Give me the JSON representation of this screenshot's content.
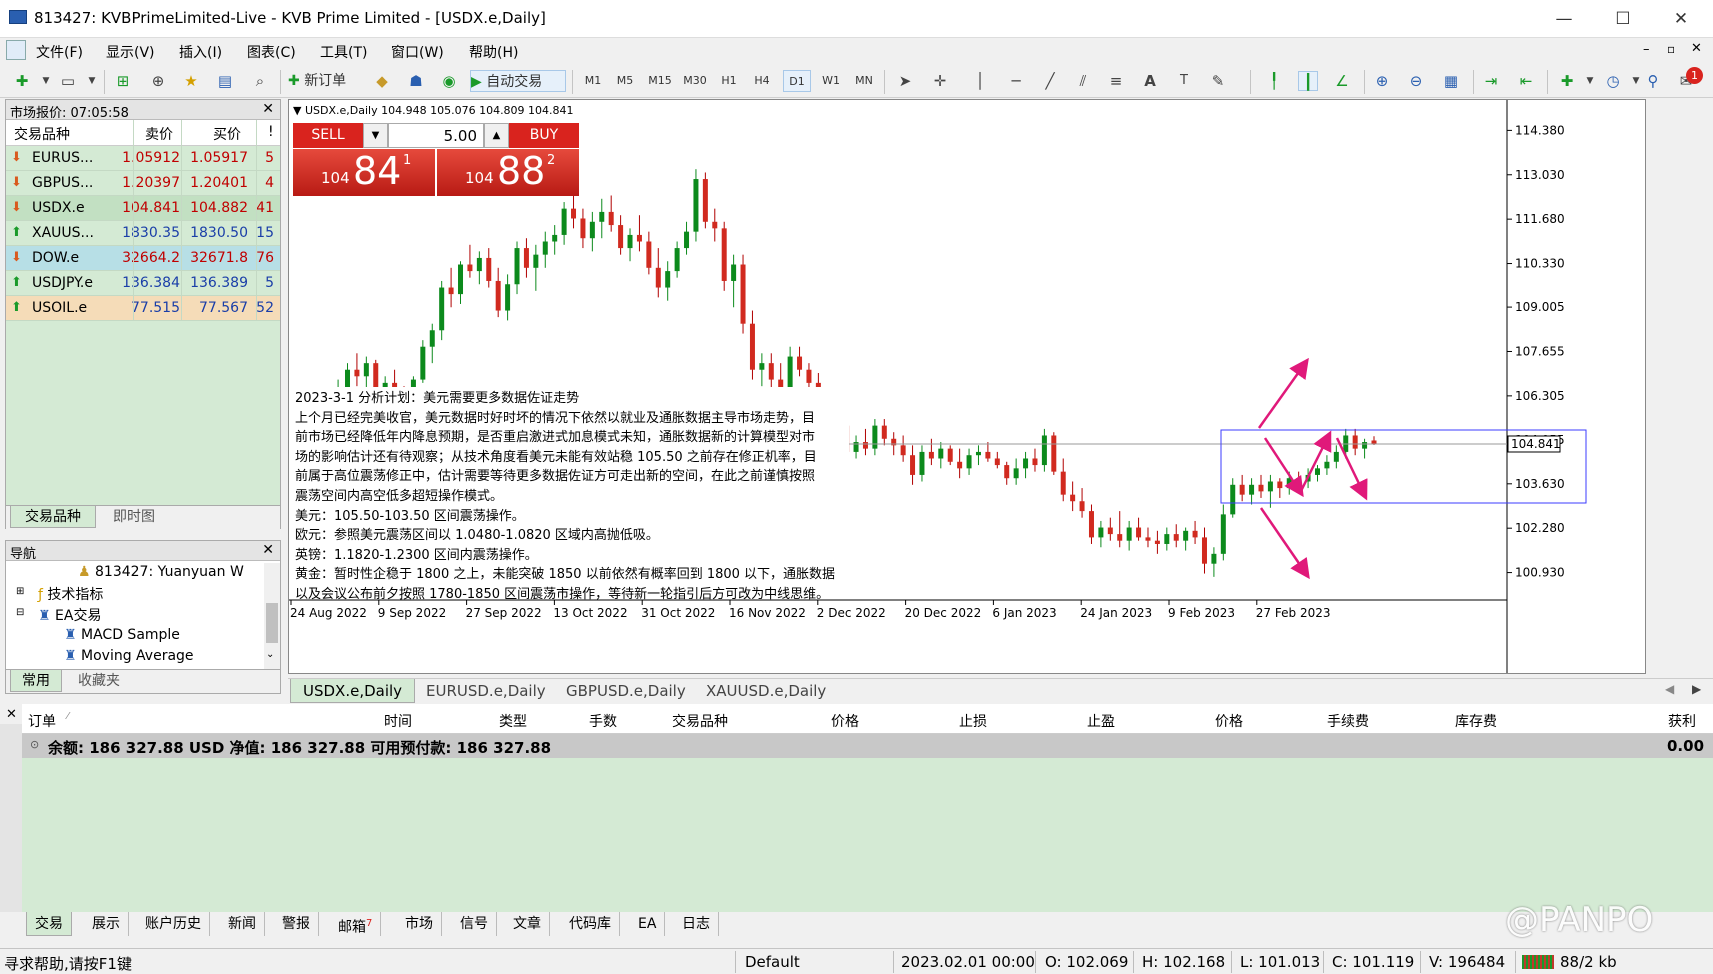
{
  "window": {
    "title": "813427: KVBPrimeLimited-Live - KVB Prime Limited - [USDX.e,Daily]"
  },
  "menu": [
    "文件(F)",
    "显示(V)",
    "插入(I)",
    "图表(C)",
    "工具(T)",
    "窗口(W)",
    "帮助(H)"
  ],
  "toolbar": {
    "new_order": "新订单",
    "auto_trade": "自动交易",
    "timeframes": [
      "M1",
      "M5",
      "M15",
      "M30",
      "H1",
      "H4",
      "D1",
      "W1",
      "MN"
    ],
    "notification_count": "1"
  },
  "market_watch": {
    "title": "市场报价: 07:05:58",
    "col_symbol": "交易品种",
    "col_bid": "卖价",
    "col_ask": "买价",
    "col_spread": "!",
    "rows": [
      {
        "symbol": "EURUS...",
        "bid": "1.05912",
        "ask": "1.05917",
        "spread": "5",
        "dir": "down",
        "bg": "#d4ead4",
        "color": "#c00000"
      },
      {
        "symbol": "GBPUS...",
        "bid": "1.20397",
        "ask": "1.20401",
        "spread": "4",
        "dir": "down",
        "bg": "#d4ead4",
        "color": "#c00000"
      },
      {
        "symbol": "USDX.e",
        "bid": "104.841",
        "ask": "104.882",
        "spread": "41",
        "dir": "down",
        "bg": "#c2e0c2",
        "color": "#c00000"
      },
      {
        "symbol": "XAUUS...",
        "bid": "1830.35",
        "ask": "1830.50",
        "spread": "15",
        "dir": "up",
        "bg": "#d4ead4",
        "color": "#1a3ea8"
      },
      {
        "symbol": "DOW.e",
        "bid": "32664.2",
        "ask": "32671.8",
        "spread": "76",
        "dir": "down",
        "bg": "#b7dfe6",
        "color": "#c00000"
      },
      {
        "symbol": "USDJPY.e",
        "bid": "136.384",
        "ask": "136.389",
        "spread": "5",
        "dir": "up",
        "bg": "#d4ead4",
        "color": "#1a3ea8"
      },
      {
        "symbol": "USOIL.e",
        "bid": "77.515",
        "ask": "77.567",
        "spread": "52",
        "dir": "up",
        "bg": "#f5dcb8",
        "color": "#1a3ea8"
      }
    ],
    "tabs": [
      "交易品种",
      "即时图"
    ]
  },
  "navigator": {
    "title": "导航",
    "account": "813427: Yuanyuan W",
    "indicators": "技术指标",
    "ea": "EA交易",
    "items": [
      "MACD Sample",
      "Moving Average"
    ],
    "tabs": [
      "常用",
      "收藏夹"
    ]
  },
  "chart": {
    "header": "USDX.e,Daily  104.948 105.076 104.809 104.841",
    "sell": "SELL",
    "buy": "BUY",
    "lot": "5.00",
    "sell_price": {
      "small": "104",
      "big": "84",
      "sup": "1"
    },
    "buy_price": {
      "small": "104",
      "big": "88",
      "sup": "2"
    },
    "current_price": "104.841",
    "price_labels": [
      "114.380",
      "113.030",
      "111.680",
      "110.330",
      "109.005",
      "107.655",
      "106.305",
      "104.955",
      "103.630",
      "102.280",
      "100.930"
    ],
    "date_labels": [
      "24 Aug 2022",
      "9 Sep 2022",
      "27 Sep 2022",
      "13 Oct 2022",
      "31 Oct 2022",
      "16 Nov 2022",
      "2 Dec 2022",
      "20 Dec 2022",
      "6 Jan 2023",
      "24 Jan 2023",
      "9 Feb 2023",
      "27 Feb 2023"
    ],
    "note": [
      "2023-3-1 分析计划：美元需要更多数据佐证走势",
      "上个月已经完美收官，美元数据时好时坏的情况下依然以就业及通胀数据主导市场走势，目",
      "前市场已经降低年内降息预期，是否重启激进式加息模式未知，通胀数据新的计算模型对市",
      "场的影响估计还有待观察；从技术角度看美元未能有效站稳 105.50 之前存在修正机率，目",
      "前属于高位震荡修正中，估计需要等待更多数据佐证方可走出新的空间，在此之前谨慎按照",
      "震荡空间内高空低多超短操作模式。",
      "美元：105.50-103.50 区间震荡操作。",
      "欧元：参照美元震荡区间以 1.0480-1.0820 区域内高抛低吸。",
      "英镑：1.1820-1.2300 区间内震荡操作。",
      "黄金：暂时性企稳于 1800 之上，未能突破 1850 以前依然有概率回到 1800 以下，通胀数据",
      "以及会议公布前夕按照 1780-1850 区间震荡市操作，等待新一轮指引后方可改为中线思维。"
    ],
    "tabs": [
      "USDX.e,Daily",
      "EURUSD.e,Daily",
      "GBPUSD.e,Daily",
      "XAUUSD.e,Daily"
    ]
  },
  "chart_data": {
    "type": "candlestick",
    "title": "USDX.e,Daily",
    "ylim": [
      100.4,
      115.0
    ],
    "candles": [
      [
        105.3,
        105.6,
        104.6,
        105.0
      ],
      [
        105.0,
        105.4,
        104.3,
        104.9
      ],
      [
        104.9,
        105.5,
        104.6,
        105.3
      ],
      [
        105.3,
        105.8,
        105.0,
        105.6
      ],
      [
        105.6,
        106.3,
        105.3,
        106.1
      ],
      [
        106.1,
        106.8,
        105.6,
        106.5
      ],
      [
        106.5,
        107.3,
        106.2,
        107.1
      ],
      [
        107.1,
        107.6,
        106.6,
        106.9
      ],
      [
        106.9,
        107.5,
        106.5,
        107.3
      ],
      [
        107.3,
        107.4,
        105.8,
        106.0
      ],
      [
        106.0,
        106.9,
        105.7,
        106.7
      ],
      [
        106.7,
        107.1,
        106.0,
        106.3
      ],
      [
        106.3,
        106.6,
        105.9,
        106.1
      ],
      [
        106.1,
        106.9,
        105.9,
        106.8
      ],
      [
        106.8,
        108.0,
        106.7,
        107.8
      ],
      [
        107.8,
        108.5,
        107.3,
        108.3
      ],
      [
        108.3,
        109.8,
        108.0,
        109.6
      ],
      [
        109.6,
        110.2,
        109.0,
        109.4
      ],
      [
        109.4,
        110.4,
        109.1,
        110.3
      ],
      [
        110.3,
        110.9,
        109.9,
        110.1
      ],
      [
        110.1,
        110.7,
        109.7,
        110.5
      ],
      [
        110.5,
        110.8,
        109.6,
        109.8
      ],
      [
        109.8,
        110.2,
        108.7,
        108.9
      ],
      [
        108.9,
        110.0,
        108.6,
        109.7
      ],
      [
        109.7,
        111.0,
        109.4,
        110.8
      ],
      [
        110.8,
        111.1,
        109.9,
        110.2
      ],
      [
        110.2,
        110.9,
        109.5,
        110.6
      ],
      [
        110.6,
        111.3,
        110.2,
        111.0
      ],
      [
        111.0,
        111.5,
        110.6,
        111.2
      ],
      [
        111.2,
        112.2,
        110.9,
        112.0
      ],
      [
        112.0,
        112.6,
        111.4,
        111.7
      ],
      [
        111.7,
        112.0,
        110.8,
        111.1
      ],
      [
        111.1,
        111.9,
        110.7,
        111.6
      ],
      [
        111.6,
        112.3,
        111.1,
        111.9
      ],
      [
        111.9,
        112.4,
        111.3,
        111.5
      ],
      [
        111.5,
        111.8,
        110.6,
        110.8
      ],
      [
        110.8,
        111.4,
        110.4,
        111.2
      ],
      [
        111.2,
        111.8,
        110.7,
        111.0
      ],
      [
        111.0,
        111.3,
        110.0,
        110.2
      ],
      [
        110.2,
        110.8,
        109.3,
        109.6
      ],
      [
        109.6,
        110.4,
        109.2,
        110.1
      ],
      [
        110.1,
        111.0,
        109.9,
        110.8
      ],
      [
        110.8,
        111.6,
        110.6,
        111.3
      ],
      [
        111.3,
        113.2,
        111.0,
        112.9
      ],
      [
        112.9,
        113.1,
        111.4,
        111.6
      ],
      [
        111.6,
        112.0,
        111.0,
        111.4
      ],
      [
        111.4,
        111.6,
        109.5,
        109.8
      ],
      [
        109.8,
        110.6,
        109.0,
        110.3
      ],
      [
        110.3,
        110.6,
        108.2,
        108.5
      ],
      [
        108.5,
        108.9,
        106.8,
        107.1
      ],
      [
        107.1,
        107.6,
        106.6,
        107.3
      ],
      [
        107.3,
        107.6,
        106.5,
        106.8
      ],
      [
        106.8,
        107.3,
        106.0,
        106.5
      ],
      [
        106.5,
        107.8,
        106.3,
        107.5
      ],
      [
        107.5,
        107.8,
        106.9,
        107.1
      ],
      [
        107.1,
        107.3,
        106.4,
        106.7
      ],
      [
        106.7,
        107.0,
        105.6,
        105.9
      ],
      [
        105.9,
        106.2,
        104.9,
        105.2
      ],
      [
        105.2,
        105.7,
        104.8,
        105.4
      ],
      [
        105.4,
        105.6,
        104.3,
        104.6
      ],
      [
        104.6,
        105.1,
        104.4,
        104.9
      ],
      [
        104.9,
        105.3,
        104.5,
        104.7
      ],
      [
        104.7,
        105.6,
        104.5,
        105.4
      ],
      [
        105.4,
        105.6,
        104.8,
        105.0
      ],
      [
        105.0,
        105.2,
        104.5,
        104.8
      ],
      [
        104.8,
        105.1,
        104.3,
        104.5
      ],
      [
        104.5,
        104.8,
        103.6,
        103.9
      ],
      [
        103.9,
        104.8,
        103.7,
        104.6
      ],
      [
        104.6,
        105.0,
        104.2,
        104.4
      ],
      [
        104.4,
        104.9,
        104.1,
        104.7
      ],
      [
        104.7,
        104.8,
        104.2,
        104.3
      ],
      [
        104.3,
        104.7,
        103.8,
        104.1
      ],
      [
        104.1,
        104.7,
        103.9,
        104.5
      ],
      [
        104.5,
        104.8,
        104.2,
        104.6
      ],
      [
        104.6,
        104.9,
        104.3,
        104.4
      ],
      [
        104.4,
        104.6,
        104.1,
        104.2
      ],
      [
        104.2,
        104.3,
        103.6,
        103.8
      ],
      [
        103.8,
        104.4,
        103.6,
        104.1
      ],
      [
        104.1,
        104.6,
        103.8,
        104.4
      ],
      [
        104.4,
        104.7,
        104.0,
        104.2
      ],
      [
        104.2,
        105.3,
        104.0,
        105.1
      ],
      [
        105.1,
        105.2,
        103.9,
        104.0
      ],
      [
        104.0,
        104.4,
        103.1,
        103.3
      ],
      [
        103.3,
        103.7,
        102.8,
        103.1
      ],
      [
        103.1,
        103.5,
        102.6,
        102.8
      ],
      [
        102.8,
        103.0,
        101.8,
        102.0
      ],
      [
        102.0,
        102.5,
        101.7,
        102.3
      ],
      [
        102.3,
        102.6,
        101.9,
        102.1
      ],
      [
        102.1,
        102.8,
        101.7,
        101.9
      ],
      [
        101.9,
        102.5,
        101.6,
        102.3
      ],
      [
        102.3,
        102.6,
        101.9,
        102.0
      ],
      [
        102.0,
        102.3,
        101.7,
        101.9
      ],
      [
        101.9,
        102.2,
        101.5,
        101.8
      ],
      [
        101.8,
        102.3,
        101.6,
        102.1
      ],
      [
        102.1,
        102.4,
        101.7,
        101.9
      ],
      [
        101.9,
        102.3,
        101.6,
        102.2
      ],
      [
        102.2,
        102.5,
        101.8,
        102.0
      ],
      [
        102.0,
        102.3,
        100.9,
        101.2
      ],
      [
        101.2,
        101.7,
        100.8,
        101.5
      ],
      [
        101.5,
        103.0,
        101.3,
        102.7
      ],
      [
        102.7,
        103.8,
        102.6,
        103.6
      ],
      [
        103.6,
        103.9,
        103.1,
        103.3
      ],
      [
        103.3,
        103.8,
        103.0,
        103.6
      ],
      [
        103.6,
        103.9,
        103.2,
        103.4
      ],
      [
        103.4,
        103.9,
        102.9,
        103.7
      ],
      [
        103.7,
        103.8,
        103.2,
        103.5
      ],
      [
        103.5,
        104.0,
        103.3,
        103.8
      ],
      [
        103.8,
        104.0,
        103.6,
        103.7
      ],
      [
        103.7,
        104.1,
        103.5,
        103.9
      ],
      [
        103.9,
        104.2,
        103.7,
        104.1
      ],
      [
        104.1,
        104.5,
        103.9,
        104.3
      ],
      [
        104.3,
        104.8,
        104.1,
        104.6
      ],
      [
        104.6,
        105.3,
        104.4,
        105.1
      ],
      [
        105.1,
        105.3,
        104.5,
        104.7
      ],
      [
        104.7,
        105.0,
        104.4,
        104.9
      ],
      [
        104.948,
        105.076,
        104.809,
        104.841
      ]
    ]
  },
  "trade": {
    "cols": [
      "订单",
      "时间",
      "类型",
      "手数",
      "交易品种",
      "价格",
      "止损",
      "止盈",
      "价格",
      "手续费",
      "库存费",
      "获利"
    ],
    "summary": "余额: 186 327.88 USD  净值: 186 327.88  可用预付款: 186 327.88",
    "profit": "0.00",
    "tabs": [
      "交易",
      "展示",
      "账户历史",
      "新闻",
      "警报",
      "邮箱",
      "市场",
      "信号",
      "文章",
      "代码库",
      "EA",
      "日志"
    ],
    "mail_badge": "7"
  },
  "status": {
    "help": "寻求帮助,请按F1键",
    "profile": "Default",
    "time": "2023.02.01 00:00",
    "open": "O: 102.069",
    "high": "H: 102.168",
    "low": "L: 101.013",
    "close": "C: 101.119",
    "volume": "V: 196484",
    "traffic": "88/2 kb"
  },
  "watermark": "@PANPO"
}
